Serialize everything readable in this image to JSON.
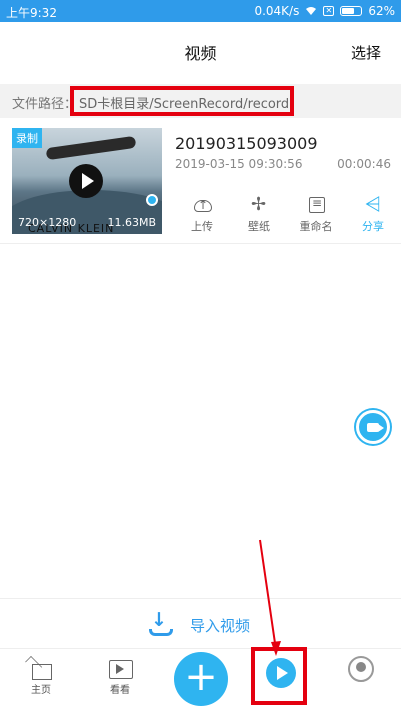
{
  "status_bar": {
    "time": "上午9:32",
    "speed": "0.04K/s",
    "battery": "62%"
  },
  "header": {
    "title": "视频",
    "select_label": "选择"
  },
  "path_bar": {
    "label": "文件路径：",
    "value": "SD卡根目录/ScreenRecord/record"
  },
  "video_item": {
    "tag": "录制",
    "name": "20190315093009",
    "date": "2019-03-15 09:30:56",
    "duration": "00:00:46",
    "resolution": "720×1280",
    "size": "11.63MB",
    "thumbnail_text": "CALVIN KLEIN",
    "actions": [
      {
        "label": "上传",
        "icon": "upload-icon"
      },
      {
        "label": "壁纸",
        "icon": "wallpaper-icon"
      },
      {
        "label": "重命名",
        "icon": "rename-icon"
      },
      {
        "label": "分享",
        "icon": "share-icon"
      }
    ]
  },
  "import": {
    "label": "导入视频",
    "icon": "import-icon"
  },
  "tabbar": {
    "home_label": "主页",
    "watch_label": "看看",
    "add_symbol": "+"
  },
  "colors": {
    "accent": "#2fb4f0",
    "status": "#2f9bea",
    "highlight": "#e4000f"
  }
}
